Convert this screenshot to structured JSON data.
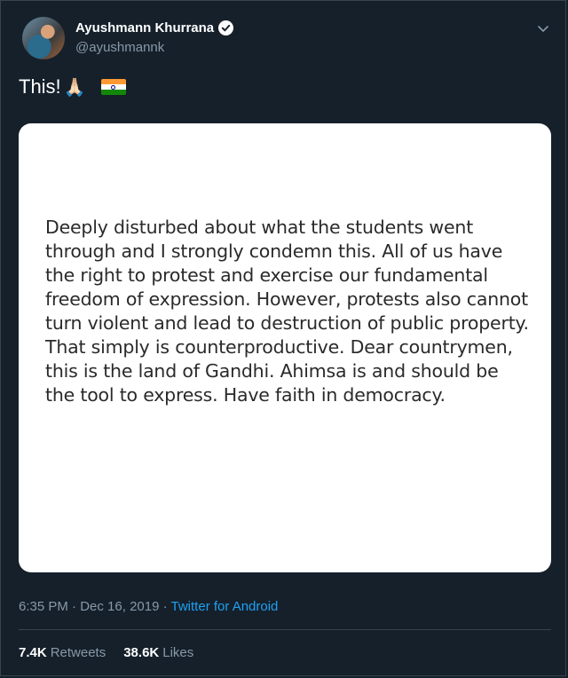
{
  "author": {
    "name": "Ayushmann Khurrana",
    "handle": "@ayushmannk"
  },
  "tweet": {
    "text": "This!",
    "emoji_hands": "🙏🏻",
    "flag_icon": "india-flag-icon"
  },
  "card": {
    "text": "Deeply disturbed about what the students went through and I strongly condemn this. All of us have the right to protest and exercise our fundamental freedom of expression. However, protests also cannot turn violent and lead to destruction of public property. That simply is counterproductive. Dear countrymen, this is the land of Gandhi. Ahimsa is and should be the tool to express. Have faith in democracy."
  },
  "meta": {
    "time": "6:35 PM",
    "separator": " · ",
    "date": "Dec 16, 2019",
    "source": "Twitter for Android"
  },
  "stats": {
    "retweets_count": "7.4K",
    "retweets_label": "Retweets",
    "likes_count": "38.6K",
    "likes_label": "Likes"
  },
  "colors": {
    "background": "#15202b",
    "text_secondary": "#8899a6",
    "link": "#1da1f2"
  }
}
